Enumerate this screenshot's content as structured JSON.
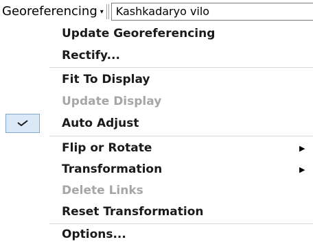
{
  "toolbar": {
    "menu_label": "Georeferencing",
    "caret": "▾",
    "layer_value": "Kashkadaryo vilo"
  },
  "menu": {
    "items": [
      {
        "label": "Update Georeferencing",
        "enabled": true
      },
      {
        "label": "Rectify...",
        "enabled": true
      },
      {
        "label": "Fit To Display",
        "enabled": true
      },
      {
        "label": "Update Display",
        "enabled": false
      },
      {
        "label": "Auto Adjust",
        "enabled": true,
        "checked": true
      },
      {
        "label": "Flip or Rotate",
        "enabled": true,
        "submenu": true,
        "arrow": "▶"
      },
      {
        "label": "Transformation",
        "enabled": true,
        "submenu": true,
        "arrow": "▶"
      },
      {
        "label": "Delete Links",
        "enabled": false
      },
      {
        "label": "Reset Transformation",
        "enabled": true
      },
      {
        "label": "Options...",
        "enabled": true
      }
    ]
  },
  "icons": {
    "checkmark": "check-icon",
    "submenu_arrow": "submenu-arrow-icon",
    "dropdown_caret": "chevron-down-icon"
  },
  "colors": {
    "disabled_text": "#a6a6a6",
    "check_highlight_bg": "#dbe8f6",
    "check_highlight_border": "#7ea6d8",
    "separator": "#d9d9d9"
  }
}
